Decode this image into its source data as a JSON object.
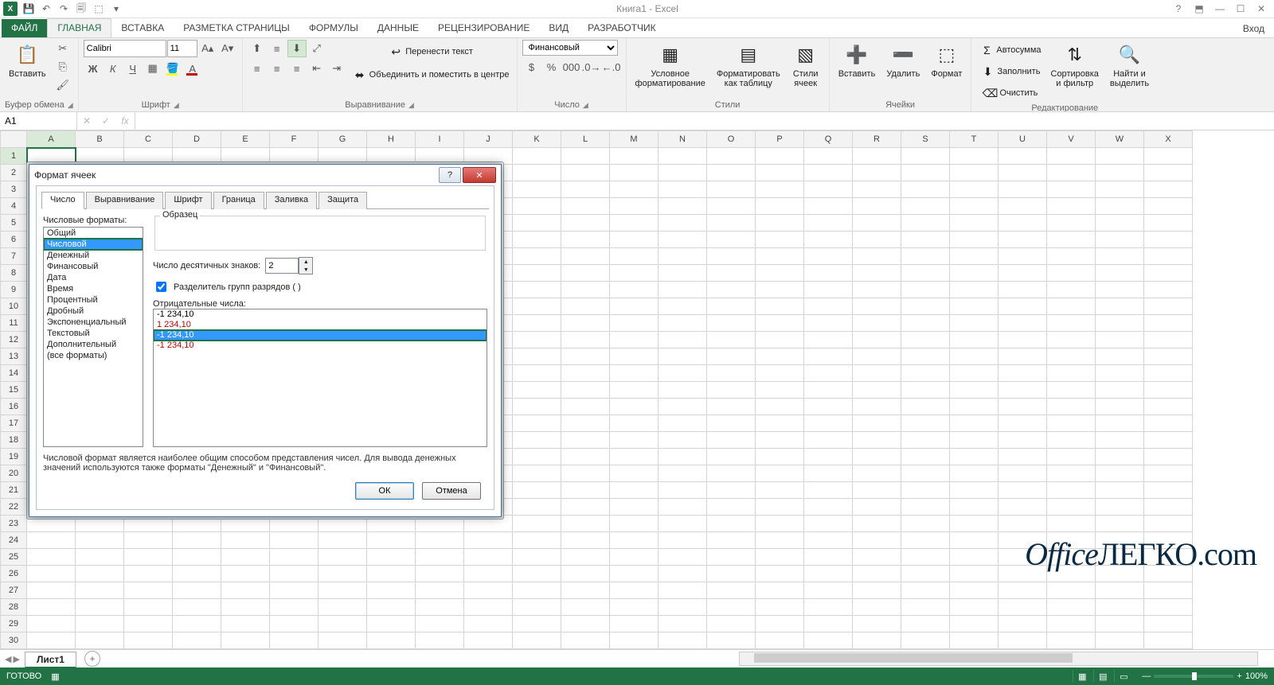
{
  "title": "Книга1 - Excel",
  "signin": "Вход",
  "tabs": {
    "file": "ФАЙЛ",
    "items": [
      "ГЛАВНАЯ",
      "ВСТАВКА",
      "РАЗМЕТКА СТРАНИЦЫ",
      "ФОРМУЛЫ",
      "ДАННЫЕ",
      "РЕЦЕНЗИРОВАНИЕ",
      "ВИД",
      "РАЗРАБОТЧИК"
    ],
    "active": 0
  },
  "ribbon": {
    "clipboard": {
      "label": "Буфер обмена",
      "paste": "Вставить"
    },
    "font": {
      "label": "Шрифт",
      "name": "Calibri",
      "size": "11"
    },
    "align": {
      "label": "Выравнивание",
      "wrap": "Перенести текст",
      "merge": "Объединить и поместить в центре"
    },
    "number": {
      "label": "Число",
      "format": "Финансовый"
    },
    "styles": {
      "label": "Стили",
      "cond": "Условное\nформатирование",
      "table": "Форматировать\nкак таблицу",
      "cell": "Стили\nячеек"
    },
    "cells": {
      "label": "Ячейки",
      "insert": "Вставить",
      "delete": "Удалить",
      "format": "Формат"
    },
    "editing": {
      "label": "Редактирование",
      "autosum": "Автосумма",
      "fill": "Заполнить",
      "clear": "Очистить",
      "sort": "Сортировка\nи фильтр",
      "find": "Найти и\nвыделить"
    }
  },
  "namebox": "A1",
  "columns": [
    "A",
    "B",
    "C",
    "D",
    "E",
    "F",
    "G",
    "H",
    "I",
    "J",
    "K",
    "L",
    "M",
    "N",
    "O",
    "P",
    "Q",
    "R",
    "S",
    "T",
    "U",
    "V",
    "W",
    "X"
  ],
  "rows": 31,
  "sheet": {
    "tab": "Лист1"
  },
  "status": {
    "ready": "ГОТОВО",
    "zoom": "100%"
  },
  "dialog": {
    "title": "Формат ячеек",
    "tabs": [
      "Число",
      "Выравнивание",
      "Шрифт",
      "Граница",
      "Заливка",
      "Защита"
    ],
    "activeTab": 0,
    "catLabel": "Числовые форматы:",
    "categories": [
      "Общий",
      "Числовой",
      "Денежный",
      "Финансовый",
      "Дата",
      "Время",
      "Процентный",
      "Дробный",
      "Экспоненциальный",
      "Текстовый",
      "Дополнительный",
      "(все форматы)"
    ],
    "catSelected": 1,
    "sampleLabel": "Образец",
    "decLabel": "Число десятичных знаков:",
    "decValue": "2",
    "sepLabel": "Разделитель групп разрядов ( )",
    "negLabel": "Отрицательные числа:",
    "negatives": [
      {
        "text": "-1 234,10",
        "color": "#000"
      },
      {
        "text": "1 234,10",
        "color": "#c00000"
      },
      {
        "text": "-1 234,10",
        "color": "#000",
        "sel": true
      },
      {
        "text": "-1 234,10",
        "color": "#c00000"
      }
    ],
    "desc": "Числовой формат является наиболее общим способом представления чисел. Для вывода денежных значений используются также форматы \"Денежный\" и \"Финансовый\".",
    "ok": "ОК",
    "cancel": "Отмена"
  },
  "watermark": {
    "a": "Office",
    "b": "ЛЕГКО",
    "c": ".com"
  }
}
